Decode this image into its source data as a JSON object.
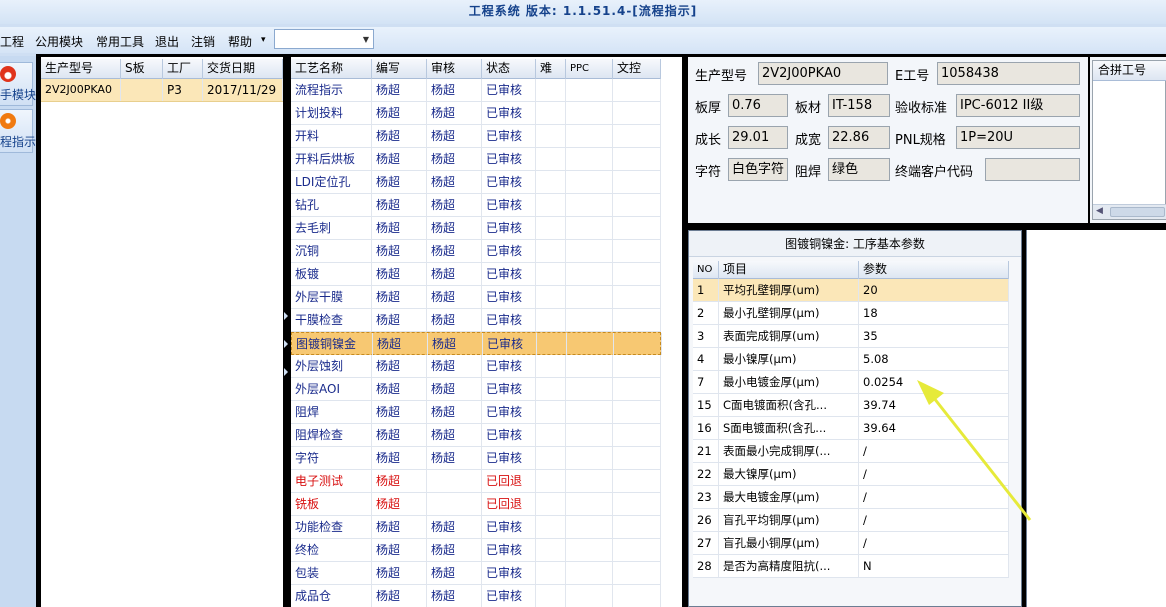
{
  "window": {
    "title": "工程系统 版本: 1.1.51.4-[流程指示]"
  },
  "menu": {
    "items": [
      "工程",
      "公用模块",
      "常用工具",
      "退出",
      "注销",
      "帮助"
    ],
    "help_arrow": "▾",
    "combo_value": "",
    "combo_arrow": "▼"
  },
  "leftbar": {
    "buttons": [
      {
        "label": "手模块",
        "icon": "fire-icon",
        "color": "#e0341c"
      },
      {
        "label": "程指示",
        "icon": "process-icon",
        "color": "#f07a10"
      }
    ]
  },
  "orders": {
    "headers": [
      "生产型号",
      "S板",
      "工厂",
      "交货日期"
    ],
    "rows": [
      [
        "2V2J00PKA0",
        "",
        "P3",
        "2017/11/29"
      ]
    ]
  },
  "process": {
    "headers": [
      "工艺名称",
      "编写",
      "审核",
      "状态",
      "难",
      "PPC",
      "文控"
    ],
    "rows": [
      {
        "name": "流程指示",
        "writer": "杨超",
        "reviewer": "杨超",
        "status": "已审核",
        "flag": "normal"
      },
      {
        "name": "计划投料",
        "writer": "杨超",
        "reviewer": "杨超",
        "status": "已审核",
        "flag": "normal"
      },
      {
        "name": "开料",
        "writer": "杨超",
        "reviewer": "杨超",
        "status": "已审核",
        "flag": "normal"
      },
      {
        "name": "开料后烘板",
        "writer": "杨超",
        "reviewer": "杨超",
        "status": "已审核",
        "flag": "normal"
      },
      {
        "name": "LDI定位孔",
        "writer": "杨超",
        "reviewer": "杨超",
        "status": "已审核",
        "flag": "normal"
      },
      {
        "name": "钻孔",
        "writer": "杨超",
        "reviewer": "杨超",
        "status": "已审核",
        "flag": "normal"
      },
      {
        "name": "去毛刺",
        "writer": "杨超",
        "reviewer": "杨超",
        "status": "已审核",
        "flag": "normal"
      },
      {
        "name": "沉铜",
        "writer": "杨超",
        "reviewer": "杨超",
        "status": "已审核",
        "flag": "normal"
      },
      {
        "name": "板镀",
        "writer": "杨超",
        "reviewer": "杨超",
        "status": "已审核",
        "flag": "normal"
      },
      {
        "name": "外层干膜",
        "writer": "杨超",
        "reviewer": "杨超",
        "status": "已审核",
        "flag": "normal"
      },
      {
        "name": "干膜检查",
        "writer": "杨超",
        "reviewer": "杨超",
        "status": "已审核",
        "flag": "normal"
      },
      {
        "name": "图镀铜镍金",
        "writer": "杨超",
        "reviewer": "杨超",
        "status": "已审核",
        "flag": "selected"
      },
      {
        "name": "外层蚀刻",
        "writer": "杨超",
        "reviewer": "杨超",
        "status": "已审核",
        "flag": "normal"
      },
      {
        "name": "外层AOI",
        "writer": "杨超",
        "reviewer": "杨超",
        "status": "已审核",
        "flag": "normal"
      },
      {
        "name": "阻焊",
        "writer": "杨超",
        "reviewer": "杨超",
        "status": "已审核",
        "flag": "normal"
      },
      {
        "name": "阻焊检查",
        "writer": "杨超",
        "reviewer": "杨超",
        "status": "已审核",
        "flag": "normal"
      },
      {
        "name": "字符",
        "writer": "杨超",
        "reviewer": "杨超",
        "status": "已审核",
        "flag": "normal"
      },
      {
        "name": "电子测试",
        "writer": "杨超",
        "reviewer": "",
        "status": "已回退",
        "flag": "returned"
      },
      {
        "name": "铣板",
        "writer": "杨超",
        "reviewer": "",
        "status": "已回退",
        "flag": "returned"
      },
      {
        "name": "功能检查",
        "writer": "杨超",
        "reviewer": "杨超",
        "status": "已审核",
        "flag": "normal"
      },
      {
        "name": "终检",
        "writer": "杨超",
        "reviewer": "杨超",
        "status": "已审核",
        "flag": "normal"
      },
      {
        "name": "包装",
        "writer": "杨超",
        "reviewer": "杨超",
        "status": "已审核",
        "flag": "normal"
      },
      {
        "name": "成品仓",
        "writer": "杨超",
        "reviewer": "杨超",
        "status": "已审核",
        "flag": "normal"
      }
    ]
  },
  "info": {
    "model_label": "生产型号",
    "model": "2V2J00PKA0",
    "eng_label": "E工号",
    "eng": "1058438",
    "thick_label": "板厚",
    "thick": "0.76",
    "material_label": "板材",
    "material": "IT-158",
    "std_label": "验收标准",
    "std": "IPC-6012 II级",
    "len_label": "成长",
    "len": "29.01",
    "wid_label": "成宽",
    "wid": "22.86",
    "pnl_label": "PNL规格",
    "pnl": "1P=20U",
    "char_label": "字符",
    "char": "白色字符",
    "mask_label": "阻焊",
    "mask": "绿色",
    "cust_label": "终端客户代码",
    "cust": ""
  },
  "side": {
    "header": "合拼工号",
    "scroll_arrow": "◀"
  },
  "params": {
    "title": "图镀铜镍金: 工序基本参数",
    "headers": [
      "NO",
      "项目",
      "参数"
    ],
    "rows": [
      [
        "1",
        "平均孔壁铜厚(um)",
        "20"
      ],
      [
        "2",
        "最小孔壁铜厚(μm)",
        "18"
      ],
      [
        "3",
        "表面完成铜厚(um)",
        "35"
      ],
      [
        "4",
        "最小镍厚(μm)",
        "5.08"
      ],
      [
        "7",
        "最小电镀金厚(μm)",
        "0.0254"
      ],
      [
        "15",
        "C面电镀面积(含孔...",
        "39.74"
      ],
      [
        "16",
        "S面电镀面积(含孔...",
        "39.64"
      ],
      [
        "21",
        "表面最小完成铜厚(...",
        "/"
      ],
      [
        "22",
        "最大镍厚(μm)",
        "/"
      ],
      [
        "23",
        "最大电镀金厚(μm)",
        "/"
      ],
      [
        "26",
        "盲孔平均铜厚(μm)",
        "/"
      ],
      [
        "27",
        "盲孔最小铜厚(μm)",
        "/"
      ],
      [
        "28",
        "是否为高精度阻抗(...",
        "N"
      ]
    ]
  },
  "annotation": {
    "arrow_color": "#e6ea3a"
  }
}
